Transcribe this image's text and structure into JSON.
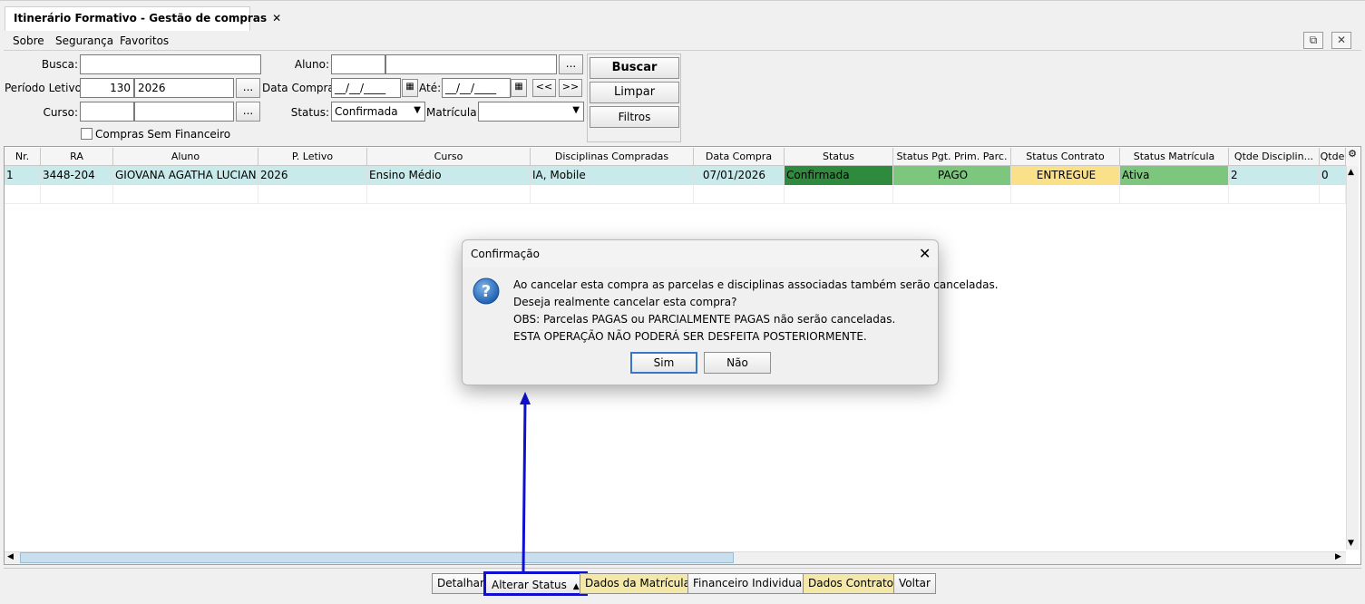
{
  "tab": {
    "title": "Itinerário Formativo - Gestão de compras",
    "close": "✕"
  },
  "menu": {
    "sobre": "Sobre",
    "seguranca": "Segurança",
    "favoritos": "Favoritos"
  },
  "window": {
    "popout": "⧉",
    "close": "✕"
  },
  "form": {
    "busca_label": "Busca:",
    "busca_value": "",
    "aluno_label": "Aluno:",
    "aluno_code": "",
    "aluno_name": "",
    "periodo_label": "Período Letivo:",
    "periodo_code": "130",
    "periodo_year": "2026",
    "data_compra_label": "Data Compra:",
    "data_compra_value": "__/__/____",
    "ate_label": "Até:",
    "ate_value": "__/__/____",
    "prev_label": "<<",
    "next_label": ">>",
    "curso_label": "Curso:",
    "curso_code": "",
    "curso_name": "",
    "status_label": "Status:",
    "status_value": "Confirmada",
    "matricula_label": "Matrícula:",
    "matricula_value": "",
    "ellipsis": "...",
    "checkbox_label": "Compras Sem Financeiro",
    "buscar": "Buscar",
    "limpar": "Limpar",
    "filtros": "Filtros"
  },
  "table": {
    "headers": [
      "Nr.",
      "RA",
      "Aluno",
      "P. Letivo",
      "Curso",
      "Disciplinas Compradas",
      "Data Compra",
      "Status",
      "Status Pgt. Prim. Parc.",
      "Status Contrato",
      "Status Matrícula",
      "Qtde Disciplin...",
      "Qtde"
    ],
    "rows": [
      [
        "1",
        "3448-204",
        "GIOVANA AGATHA LUCIAN...",
        "2026",
        "Ensino Médio",
        "IA, Mobile",
        "07/01/2026",
        "Confirmada",
        "PAGO",
        "ENTREGUE",
        "Ativa",
        "2",
        "0"
      ]
    ],
    "status_colors": {
      "confirmada": "#2e8b3d",
      "pago": "#7dc67d",
      "entregue": "#fbe08a",
      "ativa": "#7dc67d",
      "row_selected": "#c8eaea"
    }
  },
  "dialog": {
    "title": "Confirmação",
    "line1": "Ao cancelar esta compra as parcelas e disciplinas associadas também serão canceladas.",
    "line2": "Deseja realmente cancelar esta compra?",
    "line3": "OBS: Parcelas PAGAS ou PARCIALMENTE PAGAS não serão canceladas.",
    "line4": "ESTA OPERAÇÃO NÃO PODERÁ SER DESFEITA POSTERIORMENTE.",
    "yes": "Sim",
    "no": "Não"
  },
  "footer": {
    "detalhar": "Detalhar",
    "alterar_status": "Alterar Status",
    "dados_matricula": "Dados da Matrícula",
    "financeiro": "Financeiro Individual",
    "dados_contrato": "Dados Contrato",
    "voltar": "Voltar"
  },
  "annotation": {
    "color": "#1010d0"
  }
}
